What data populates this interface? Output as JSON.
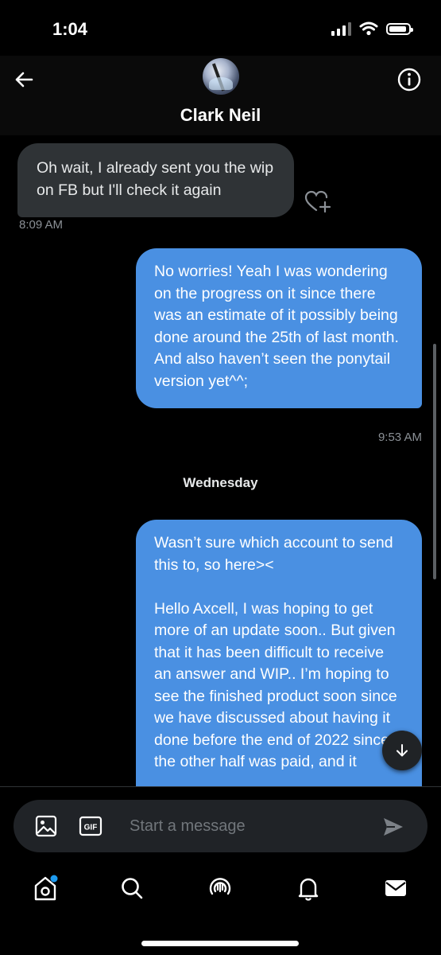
{
  "status_bar": {
    "time": "1:04"
  },
  "header": {
    "contact_name": "Clark Neil"
  },
  "messages": [
    {
      "direction": "incoming",
      "text": "Oh wait, I already sent you the wip on FB but I'll check it again",
      "timestamp": "8:09 AM"
    },
    {
      "direction": "outgoing",
      "text": "No worries! Yeah I was wondering on the progress on it since there was an estimate of it possibly being done around the 25th of last month. And also haven’t seen the ponytail version yet^^;",
      "timestamp": "9:53 AM"
    },
    {
      "direction": "outgoing",
      "text": "Wasn’t sure which account to send this to, so here><\n\nHello Axcell, I was hoping to get more of an update soon.. But given that it has been difficult to receive an answer and WIP.. I’m hoping to see the finished product soon since we have discussed about having it done before the end of 2022 since the other half was paid, and it"
    }
  ],
  "day_separator": "Wednesday",
  "composer": {
    "placeholder": "Start a message",
    "gif_label": "GIF"
  },
  "nav": {
    "items": [
      "home-icon",
      "search-icon",
      "spaces-icon",
      "notifications-icon",
      "messages-icon"
    ],
    "home_has_badge": true
  },
  "colors": {
    "outgoing_bubble": "#4a90e2",
    "incoming_bubble": "#2f3336",
    "background": "#000000",
    "badge": "#1d9bf0"
  }
}
